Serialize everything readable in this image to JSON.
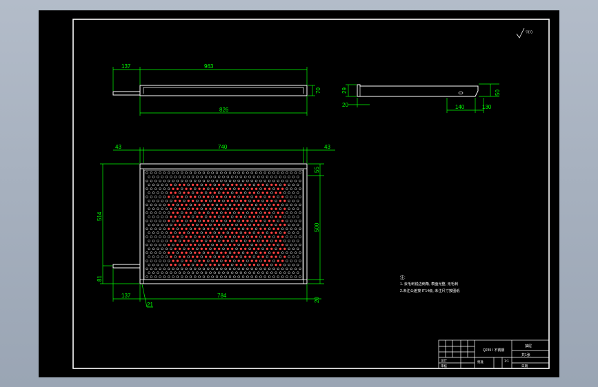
{
  "drawing": {
    "colors": {
      "background": "#000000",
      "outline": "#ffffff",
      "dimension": "#00ff00",
      "holes_outer": "#ffffff",
      "holes_inner": "#ff4040",
      "note_text": "#ffffff"
    },
    "top_view": {
      "dim_handle": "137",
      "dim_overall_length": "963",
      "dim_inner_length": "826",
      "dim_height": "70"
    },
    "side_view": {
      "dim_flange_height": "29",
      "dim_flange_width": "20",
      "dim_slot_length": "140",
      "dim_slot_offset": "130",
      "dim_total_height": "50"
    },
    "front_view": {
      "dim_left_margin": "43",
      "dim_inner_width": "740",
      "dim_right_margin": "43",
      "dim_overall_height": "514",
      "dim_top_rail": "55",
      "dim_panel_height": "500",
      "dim_handle_height": "81",
      "dim_handle_length": "137",
      "dim_bottom_width": "784",
      "dim_bottom_rail": "20",
      "dim_leader": "21",
      "perforation": {
        "rows": 27,
        "cols": 36,
        "pattern": "alternating white and red holes"
      }
    },
    "roughness_symbol": "▽(√)",
    "notes": {
      "title": "注:",
      "line1": "1. 去毛刺锐边倒角, 表面光整, 无毛刺",
      "line2": "2.未注公差按 IT14级, 未注尺寸按图纸"
    },
    "title_block": {
      "material": "Q235 / 不锈钢",
      "part_name": "抽屉",
      "scale": "1:1",
      "sheet": "共1张",
      "drawn": "设计",
      "checked": "审核",
      "approved": "批准",
      "date": "日期"
    }
  }
}
